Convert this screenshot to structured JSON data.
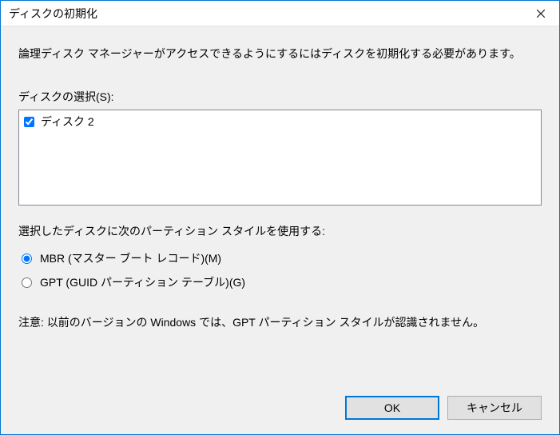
{
  "titlebar": {
    "title": "ディスクの初期化"
  },
  "body": {
    "description": "論理ディスク マネージャーがアクセスできるようにするにはディスクを初期化する必要があります。",
    "select_label": "ディスクの選択(S):",
    "disks": [
      {
        "label": "ディスク 2",
        "checked": true
      }
    ],
    "partition_style_label": "選択したディスクに次のパーティション スタイルを使用する:",
    "radios": {
      "mbr": "MBR (マスター ブート レコード)(M)",
      "gpt": "GPT (GUID パーティション テーブル)(G)",
      "selected": "mbr"
    },
    "note": "注意: 以前のバージョンの Windows では、GPT パーティション スタイルが認識されません。"
  },
  "buttons": {
    "ok": "OK",
    "cancel": "キャンセル"
  }
}
